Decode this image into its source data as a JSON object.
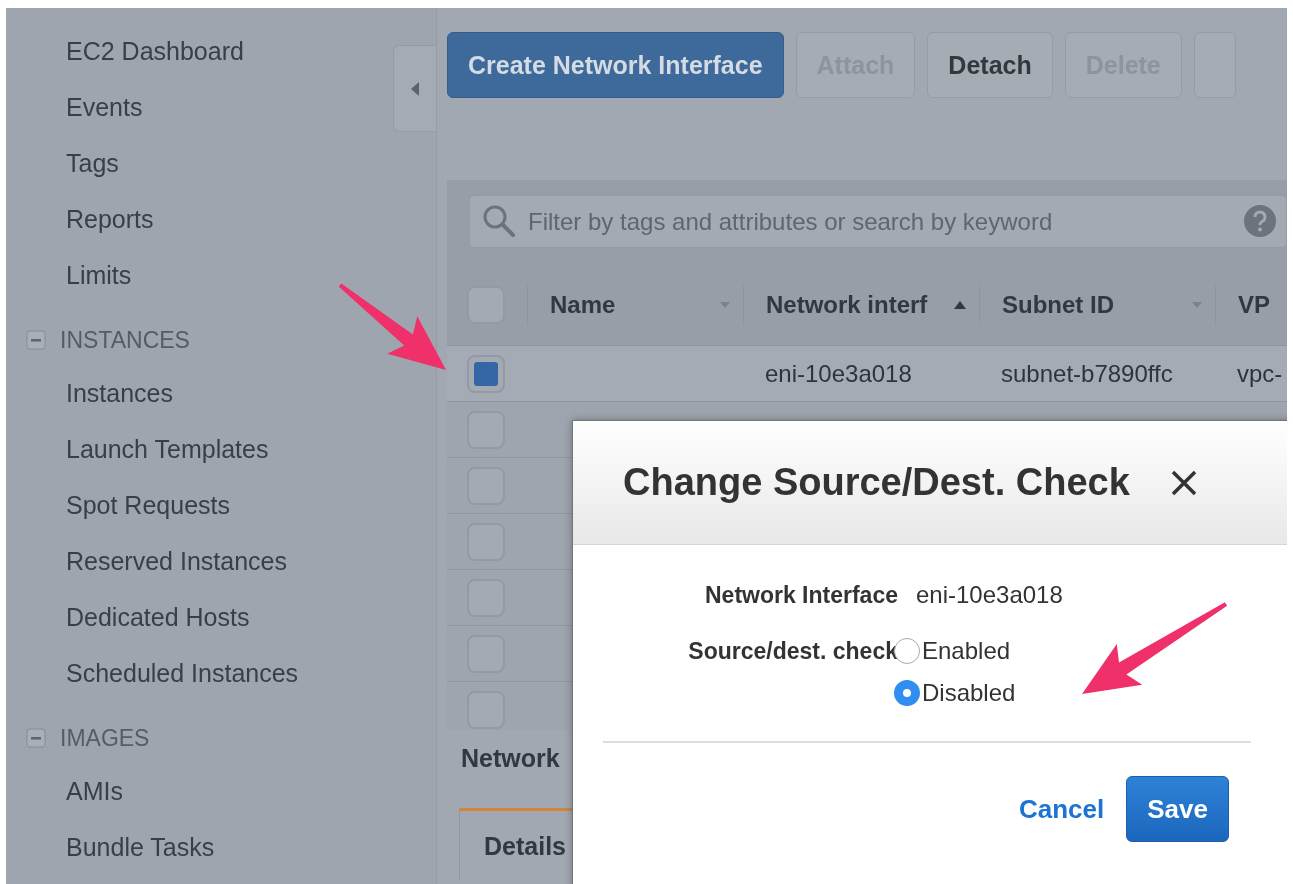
{
  "sidebar": {
    "items": [
      {
        "kind": "link",
        "label": "EC2 Dashboard"
      },
      {
        "kind": "link",
        "label": "Events"
      },
      {
        "kind": "link",
        "label": "Tags"
      },
      {
        "kind": "link",
        "label": "Reports"
      },
      {
        "kind": "link",
        "label": "Limits"
      },
      {
        "kind": "section",
        "label": "INSTANCES",
        "expanded": true
      },
      {
        "kind": "link",
        "label": "Instances"
      },
      {
        "kind": "link",
        "label": "Launch Templates"
      },
      {
        "kind": "link",
        "label": "Spot Requests"
      },
      {
        "kind": "link",
        "label": "Reserved Instances"
      },
      {
        "kind": "link",
        "label": "Dedicated Hosts"
      },
      {
        "kind": "link",
        "label": "Scheduled Instances"
      },
      {
        "kind": "section",
        "label": "IMAGES",
        "expanded": true
      },
      {
        "kind": "link",
        "label": "AMIs"
      },
      {
        "kind": "link",
        "label": "Bundle Tasks"
      }
    ]
  },
  "toolbar": {
    "buttons": [
      {
        "kind": "primary",
        "label": "Create Network Interface",
        "disabled": false
      },
      {
        "kind": "normal",
        "label": "Attach",
        "disabled": true
      },
      {
        "kind": "normal",
        "label": "Detach",
        "disabled": false
      },
      {
        "kind": "normal",
        "label": "Delete",
        "disabled": true
      }
    ]
  },
  "search": {
    "placeholder": "Filter by tags and attributes or search by keyword"
  },
  "table": {
    "select_all": {
      "checked": false
    },
    "columns": [
      {
        "label": "Name",
        "sorted": false
      },
      {
        "label": "Network interf",
        "sorted": true
      },
      {
        "label": "Subnet ID",
        "sorted": false
      },
      {
        "label": "VP"
      }
    ],
    "rows": [
      {
        "selected": true,
        "cells": [
          "",
          "eni-10e3a018",
          "subnet-b7890ffc",
          "vpc-"
        ]
      },
      {
        "selected": false,
        "cells": []
      },
      {
        "selected": false,
        "cells": []
      },
      {
        "selected": false,
        "cells": []
      },
      {
        "selected": false,
        "cells": []
      },
      {
        "selected": false,
        "cells": []
      },
      {
        "selected": false,
        "cells": []
      }
    ]
  },
  "details": {
    "title": "Network",
    "tabs": [
      {
        "label": "Details",
        "selected": true
      }
    ]
  },
  "modal": {
    "title": "Change Source/Dest. Check",
    "fields": [
      {
        "label": "Network Interface",
        "value": "eni-10e3a018"
      }
    ],
    "radio_group": {
      "label": "Source/dest. check",
      "options": [
        {
          "label": "Enabled",
          "selected": false
        },
        {
          "label": "Disabled",
          "selected": true
        }
      ]
    },
    "cancel": "Cancel",
    "save": "Save"
  }
}
